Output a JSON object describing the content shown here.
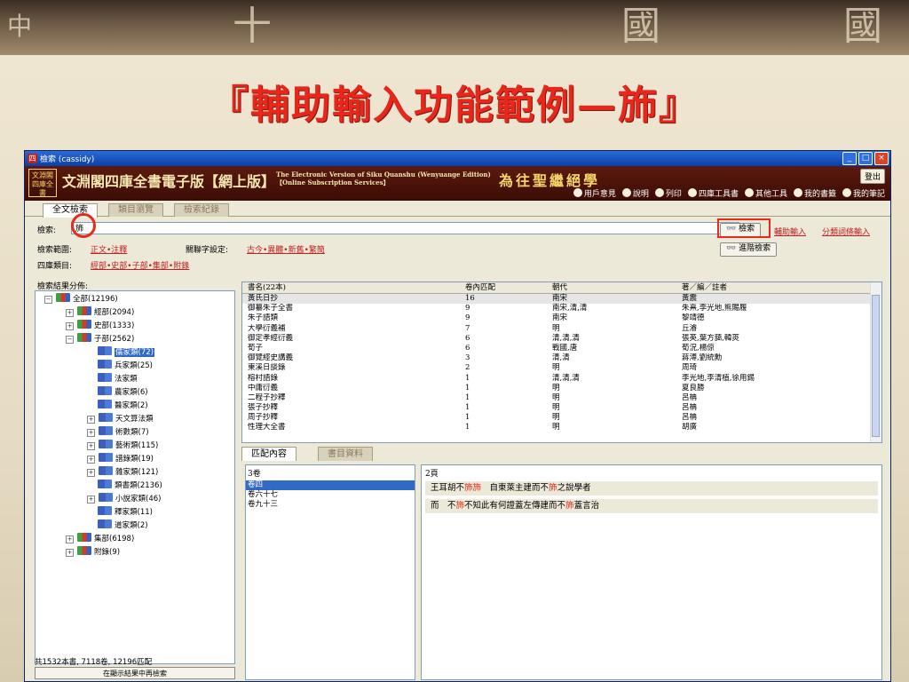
{
  "slide": {
    "title": "『輔助輸入功能範例—斾』",
    "bg_glyphs": [
      "中",
      "十",
      "國",
      "國"
    ]
  },
  "window": {
    "title": "檢索 (cassidy)",
    "icon_label": "四",
    "controls": [
      "_",
      "□",
      "×"
    ]
  },
  "banner": {
    "logo": "文淵閣四庫全書",
    "brand": "文淵閣四庫全書電子版【網上版】",
    "english_line1": "The Electronic Version of Siku Quanshu (Wenyuange Edition)",
    "english_line2": "【Online Subscription Services】",
    "motto": "為往聖繼絕學",
    "logout": "登出",
    "tools": [
      "用戶意見",
      "說明",
      "列印",
      "四庫工具書",
      "其他工具",
      "我的書籤",
      "我的筆記"
    ]
  },
  "tabs": [
    "全文檢索",
    "類目瀏覽",
    "檢索紀錄"
  ],
  "search": {
    "label": "檢索:",
    "value": "斾",
    "search_button": "檢索",
    "advanced_button": "進階檢索",
    "assist_link": "輔助輸入",
    "category_link": "分類詞條輸入",
    "range_label": "檢索範圍:",
    "range_value": "正文•注釋",
    "related_label": "關聯字設定:",
    "related_value": "古今•異體•新舊•繁簡",
    "category_label": "四庫類目:",
    "category_value": "經部•史部•子部•集部•附錄"
  },
  "tree": {
    "header": "檢索結果分佈:",
    "nodes": [
      {
        "label": "全部(12196)",
        "level": 0,
        "exp": "−"
      },
      {
        "label": "經部(2094)",
        "level": 1,
        "exp": "+"
      },
      {
        "label": "史部(1333)",
        "level": 1,
        "exp": "+"
      },
      {
        "label": "子部(2562)",
        "level": 1,
        "exp": "−"
      },
      {
        "label": "儒家類(72)",
        "level": 2,
        "exp": "",
        "selected": true
      },
      {
        "label": "兵家類(25)",
        "level": 2,
        "exp": ""
      },
      {
        "label": "法家類",
        "level": 2,
        "exp": ""
      },
      {
        "label": "農家類(6)",
        "level": 2,
        "exp": ""
      },
      {
        "label": "醫家類(2)",
        "level": 2,
        "exp": ""
      },
      {
        "label": "天文算法類",
        "level": 2,
        "exp": "+"
      },
      {
        "label": "術數類(7)",
        "level": 2,
        "exp": "+"
      },
      {
        "label": "藝術類(115)",
        "level": 2,
        "exp": "+"
      },
      {
        "label": "譜錄類(19)",
        "level": 2,
        "exp": "+"
      },
      {
        "label": "雜家類(121)",
        "level": 2,
        "exp": "+"
      },
      {
        "label": "類書類(2136)",
        "level": 2,
        "exp": ""
      },
      {
        "label": "小說家類(46)",
        "level": 2,
        "exp": "+"
      },
      {
        "label": "釋家類(11)",
        "level": 2,
        "exp": ""
      },
      {
        "label": "道家類(2)",
        "level": 2,
        "exp": ""
      },
      {
        "label": "集部(6198)",
        "level": 1,
        "exp": "+"
      },
      {
        "label": "附錄(9)",
        "level": 1,
        "exp": "+"
      }
    ],
    "footer": "共1532本書, 7118卷, 12196匹配",
    "refine_button": "在顯示結果中再檢索"
  },
  "results": {
    "headers": [
      "書名(22本)",
      "卷內匹配",
      "朝代",
      "著／編／註者"
    ],
    "rows": [
      {
        "title": "黃氏日抄",
        "count": "16",
        "dynasty": "南宋",
        "author": "黃震"
      },
      {
        "title": "御纂朱子全書",
        "count": "9",
        "dynasty": "南宋,清,清",
        "author": "朱熹,李光地,熊賜履"
      },
      {
        "title": "朱子語類",
        "count": "9",
        "dynasty": "南宋",
        "author": "黎靖德"
      },
      {
        "title": "大學衍義補",
        "count": "7",
        "dynasty": "明",
        "author": "丘濬"
      },
      {
        "title": "御定孝經衍義",
        "count": "6",
        "dynasty": "清,清,清",
        "author": "張英,葉方藹,韓菼"
      },
      {
        "title": "荀子",
        "count": "6",
        "dynasty": "戰國,唐",
        "author": "荀況,楊倞"
      },
      {
        "title": "御覽經史講義",
        "count": "3",
        "dynasty": "清,清",
        "author": "蔣溥,劉統勳"
      },
      {
        "title": "東溪日談錄",
        "count": "2",
        "dynasty": "明",
        "author": "周琦"
      },
      {
        "title": "榕村語錄",
        "count": "1",
        "dynasty": "清,清,清",
        "author": "李光地,李清植,徐用錫"
      },
      {
        "title": "中庸衍義",
        "count": "1",
        "dynasty": "明",
        "author": "夏良勝"
      },
      {
        "title": "二程子抄釋",
        "count": "1",
        "dynasty": "明",
        "author": "呂柟"
      },
      {
        "title": "張子抄釋",
        "count": "1",
        "dynasty": "明",
        "author": "呂柟"
      },
      {
        "title": "周子抄釋",
        "count": "1",
        "dynasty": "明",
        "author": "呂柟"
      },
      {
        "title": "性理大全書",
        "count": "1",
        "dynasty": "明",
        "author": "胡廣"
      }
    ]
  },
  "bottom_tabs": [
    "匹配內容",
    "書目資料"
  ],
  "volumes": {
    "header": "3卷",
    "items": [
      "卷四",
      "卷六十七",
      "卷九十三"
    ]
  },
  "page": {
    "header": "2頁",
    "snippets": [
      [
        {
          "t": "王耳胡不"
        },
        {
          "t": "斾斾",
          "hl": true
        },
        {
          "t": "　自東萊主建而不"
        },
        {
          "t": "斾",
          "hl": true
        },
        {
          "t": "之說學者"
        }
      ],
      [
        {
          "t": "而　不"
        },
        {
          "t": "斾",
          "hl": true
        },
        {
          "t": "不知此有何證蓋左傳建而不"
        },
        {
          "t": "斾",
          "hl": true
        },
        {
          "t": "蓋言治"
        }
      ]
    ]
  },
  "colors": {
    "accent_red": "#e82a1c",
    "selection_blue": "#316ac5",
    "title_red": "#e8261a"
  }
}
